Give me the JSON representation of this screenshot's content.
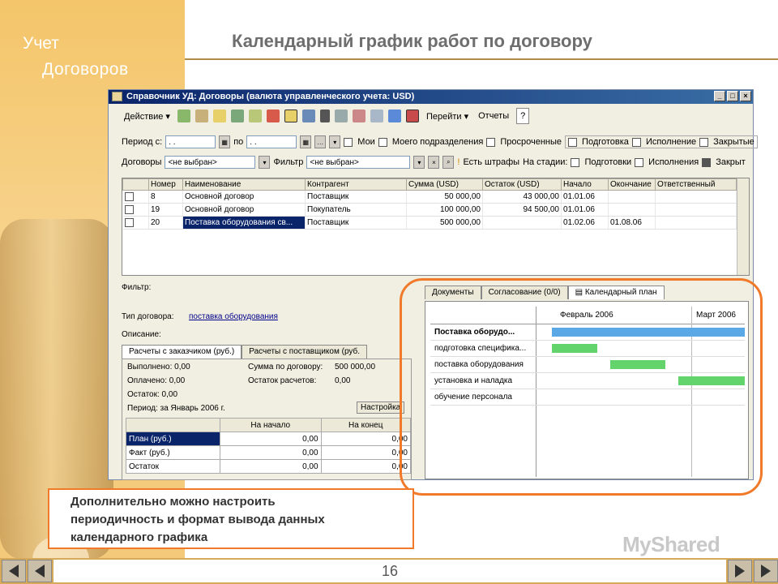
{
  "sidebar": {
    "brand_line1": "Учет",
    "brand_line2": "Договоров"
  },
  "page_title": "Календарный график работ по договору",
  "window": {
    "title": "Справочник УД: Договоры (валюта управленческого учета: USD)",
    "btn_min": "_",
    "btn_max": "□",
    "btn_close": "×"
  },
  "toolbar": {
    "action": "Действие ▾",
    "goto": "Перейти ▾",
    "reports": "Отчеты",
    "help": "?"
  },
  "filters": {
    "period_from": "Период с:",
    "period_from_val": ". .",
    "period_to": "по",
    "period_to_val": ". .",
    "mine": "Мои",
    "my_dept": "Моего подразделения",
    "overdue": "Просроченные",
    "prep": "Подготовка",
    "exec": "Исполнение",
    "closed": "Закрытые",
    "contracts": "Договоры",
    "contracts_val": "<не выбран>",
    "filter": "Фильтр",
    "filter_val": "<не выбран>",
    "fines": "Есть штрафы",
    "at_stage": "На стадии:",
    "stage_prep": "Подготовки",
    "stage_exec": "Исполнения",
    "stage_closed": "Закрыт"
  },
  "grid": {
    "columns": [
      "Номер",
      "Наименование",
      "Контрагент",
      "Сумма (USD)",
      "Остаток (USD)",
      "Начало",
      "Окончание",
      "Ответственный"
    ],
    "rows": [
      [
        "8",
        "Основной договор",
        "Поставщик",
        "50 000,00",
        "43 000,00",
        "01.01.06",
        "",
        ""
      ],
      [
        "19",
        "Основной договор",
        "Покупатель",
        "100 000,00",
        "94 500,00",
        "01.01.06",
        "",
        ""
      ],
      [
        "20",
        "Поставка оборудования св...",
        "Поставщик",
        "500 000,00",
        "",
        "01.02.06",
        "01.08.06",
        ""
      ]
    ]
  },
  "details": {
    "filter": "Фильтр:",
    "type_label": "Тип договора:",
    "type_val": "поставка оборудования",
    "desc": "Описание:",
    "tab1": "Расчеты с заказчиком (руб.)",
    "tab2": "Расчеты с поставщиком (руб.",
    "done": "Выполнено: 0,00",
    "paid": "Оплачено: 0,00",
    "rest": "Остаток: 0,00",
    "sum": "Сумма по договору:",
    "sum_val": "500 000,00",
    "rest_calc": "Остаток расчетов:",
    "rest_calc_val": "0,00",
    "period": "Период: за Январь 2006 г.",
    "settings": "Настройка",
    "sub_cols": [
      "",
      "На начало",
      "На конец"
    ],
    "sub_rows": [
      [
        "План (руб.)",
        "0,00",
        "0,00"
      ],
      [
        "Факт (руб.)",
        "0,00",
        "0,00"
      ],
      [
        "Остаток",
        "0,00",
        "0,00"
      ]
    ]
  },
  "gantt": {
    "tab_docs": "Документы",
    "tab_approval": "Согласование (0/0)",
    "tab_plan": "Календарный план",
    "month1": "Февраль 2006",
    "month2": "Март 2006",
    "tasks": [
      {
        "name": "Поставка оборудо...",
        "bold": true,
        "color": "#5aa9e6"
      },
      {
        "name": "подготовка специфика...",
        "color": "#63d36b"
      },
      {
        "name": "поставка оборудования",
        "color": "#63d36b"
      },
      {
        "name": "установка и наладка",
        "color": "#63d36b"
      },
      {
        "name": "обучение персонала",
        "color": ""
      }
    ]
  },
  "note": {
    "line1": "Дополнительно можно настроить",
    "line2": "периодичность и формат вывода данных",
    "line3": "календарного графика"
  },
  "footer": {
    "page": "16"
  },
  "watermark": "MyShared"
}
